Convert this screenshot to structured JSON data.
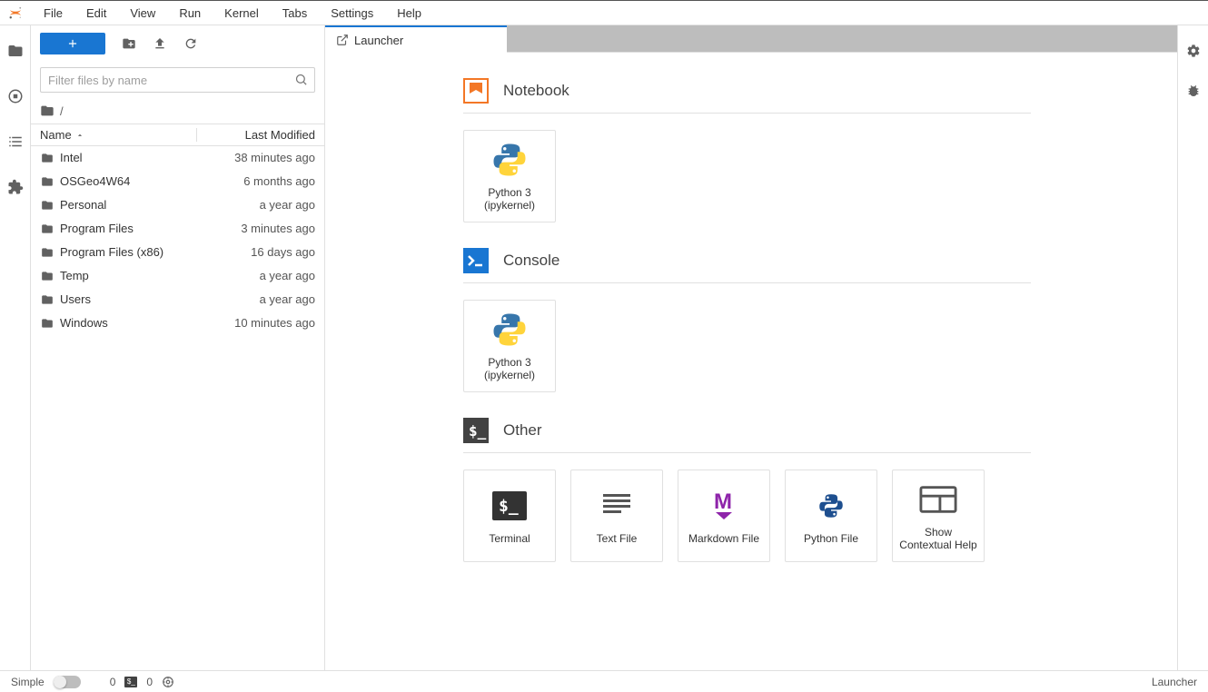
{
  "menus": [
    "File",
    "Edit",
    "View",
    "Run",
    "Kernel",
    "Tabs",
    "Settings",
    "Help"
  ],
  "sidebar": {
    "search_placeholder": "Filter files by name",
    "path_sep": "/",
    "col_name": "Name",
    "col_modified": "Last Modified",
    "files": [
      {
        "name": "Intel",
        "modified": "38 minutes ago"
      },
      {
        "name": "OSGeo4W64",
        "modified": "6 months ago"
      },
      {
        "name": "Personal",
        "modified": "a year ago"
      },
      {
        "name": "Program Files",
        "modified": "3 minutes ago"
      },
      {
        "name": "Program Files (x86)",
        "modified": "16 days ago"
      },
      {
        "name": "Temp",
        "modified": "a year ago"
      },
      {
        "name": "Users",
        "modified": "a year ago"
      },
      {
        "name": "Windows",
        "modified": "10 minutes ago"
      }
    ]
  },
  "tab": {
    "label": "Launcher"
  },
  "launcher": {
    "notebook": {
      "title": "Notebook",
      "card": "Python 3 (ipykernel)"
    },
    "console": {
      "title": "Console",
      "card": "Python 3 (ipykernel)"
    },
    "other": {
      "title": "Other",
      "cards": [
        "Terminal",
        "Text File",
        "Markdown File",
        "Python File",
        "Show Contextual Help"
      ]
    }
  },
  "status": {
    "mode": "Simple",
    "count_terminals": "0",
    "count_kernels": "0",
    "context": "Launcher"
  }
}
